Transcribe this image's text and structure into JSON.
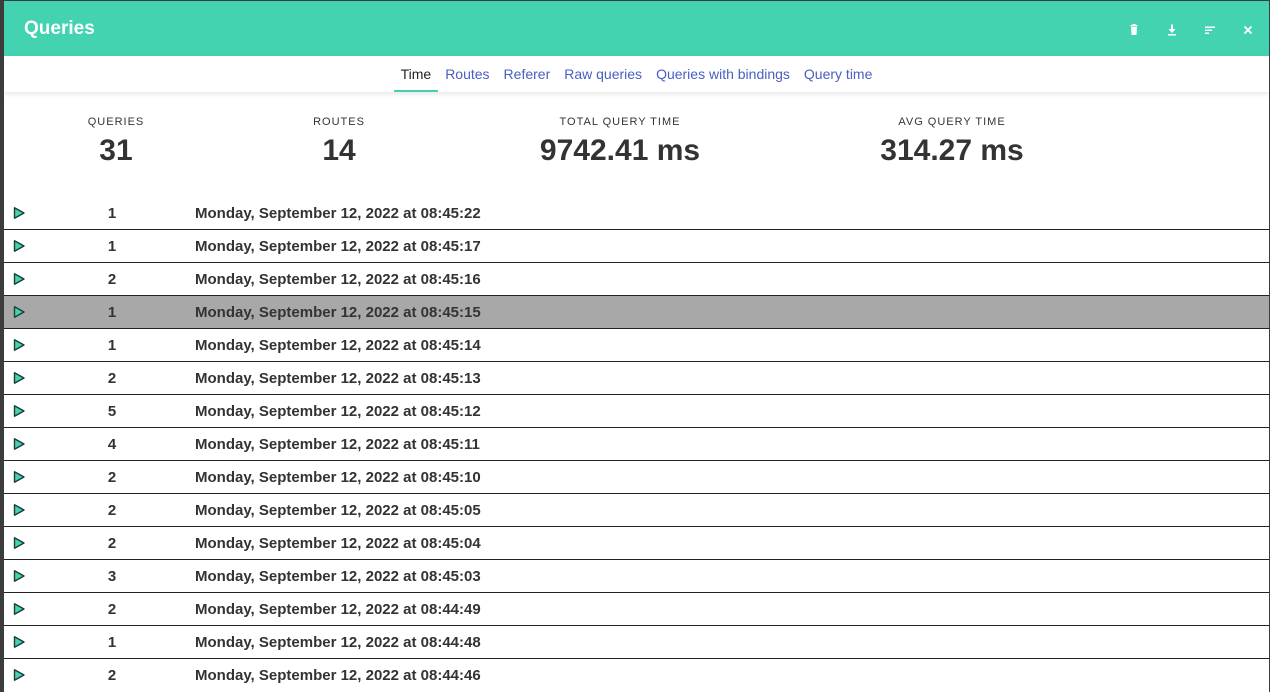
{
  "header": {
    "title": "Queries",
    "accent_color": "#43d3b0",
    "actions": [
      {
        "name": "trash-icon"
      },
      {
        "name": "download-icon"
      },
      {
        "name": "sort-icon"
      },
      {
        "name": "close-icon"
      }
    ]
  },
  "tabs": [
    {
      "label": "Time",
      "active": true
    },
    {
      "label": "Routes",
      "active": false
    },
    {
      "label": "Referer",
      "active": false
    },
    {
      "label": "Raw queries",
      "active": false
    },
    {
      "label": "Queries with bindings",
      "active": false
    },
    {
      "label": "Query time",
      "active": false
    }
  ],
  "stats": {
    "queries": {
      "label": "QUERIES",
      "value": "31"
    },
    "routes": {
      "label": "ROUTES",
      "value": "14"
    },
    "total_time": {
      "label": "TOTAL QUERY TIME",
      "value": "9742.41 ms"
    },
    "avg_time": {
      "label": "AVG QUERY TIME",
      "value": "314.27 ms"
    }
  },
  "rows": [
    {
      "count": "1",
      "timestamp": "Monday, September 12, 2022 at 08:45:22"
    },
    {
      "count": "1",
      "timestamp": "Monday, September 12, 2022 at 08:45:17"
    },
    {
      "count": "2",
      "timestamp": "Monday, September 12, 2022 at 08:45:16"
    },
    {
      "count": "1",
      "timestamp": "Monday, September 12, 2022 at 08:45:15",
      "highlighted": true
    },
    {
      "count": "1",
      "timestamp": "Monday, September 12, 2022 at 08:45:14"
    },
    {
      "count": "2",
      "timestamp": "Monday, September 12, 2022 at 08:45:13"
    },
    {
      "count": "5",
      "timestamp": "Monday, September 12, 2022 at 08:45:12"
    },
    {
      "count": "4",
      "timestamp": "Monday, September 12, 2022 at 08:45:11"
    },
    {
      "count": "2",
      "timestamp": "Monday, September 12, 2022 at 08:45:10"
    },
    {
      "count": "2",
      "timestamp": "Monday, September 12, 2022 at 08:45:05"
    },
    {
      "count": "2",
      "timestamp": "Monday, September 12, 2022 at 08:45:04"
    },
    {
      "count": "3",
      "timestamp": "Monday, September 12, 2022 at 08:45:03"
    },
    {
      "count": "2",
      "timestamp": "Monday, September 12, 2022 at 08:44:49"
    },
    {
      "count": "1",
      "timestamp": "Monday, September 12, 2022 at 08:44:48"
    },
    {
      "count": "2",
      "timestamp": "Monday, September 12, 2022 at 08:44:46"
    }
  ]
}
